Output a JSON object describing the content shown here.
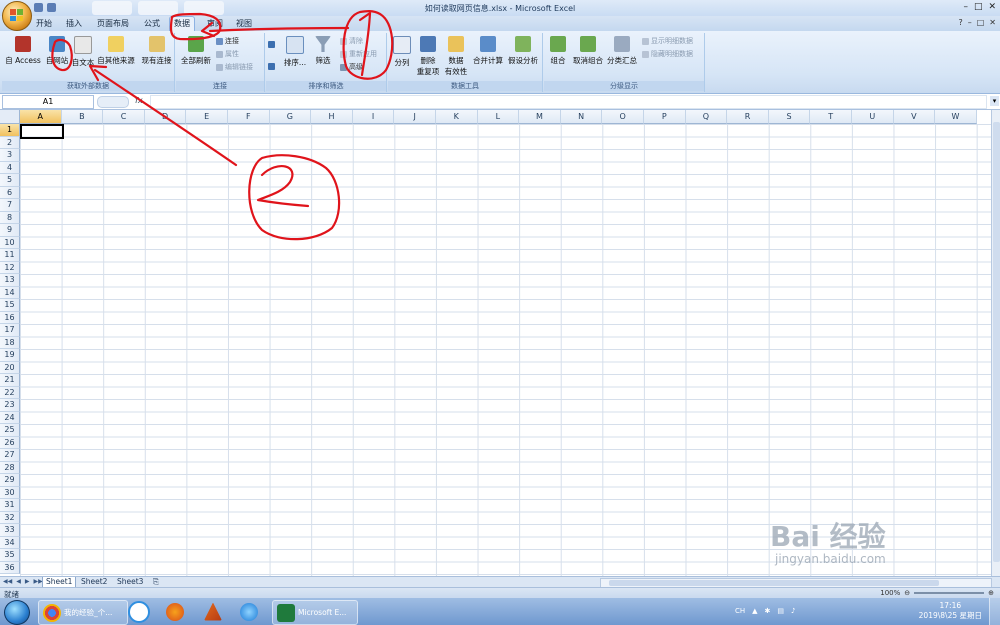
{
  "window": {
    "title": "如何读取网页信息.xlsx - Microsoft Excel",
    "controls": [
      "–",
      "□",
      "✕"
    ]
  },
  "tabs": [
    {
      "label": "开始",
      "active": false
    },
    {
      "label": "插入",
      "active": false
    },
    {
      "label": "页面布局",
      "active": false
    },
    {
      "label": "公式",
      "active": false
    },
    {
      "label": "数据",
      "active": true
    },
    {
      "label": "审阅",
      "active": false
    },
    {
      "label": "视图",
      "active": false
    }
  ],
  "ribbon": {
    "groups": [
      {
        "label": "获取外部数据"
      },
      {
        "label": "连接"
      },
      {
        "label": "排序和筛选"
      },
      {
        "label": "数据工具"
      },
      {
        "label": "分级显示"
      }
    ],
    "external": {
      "access": "自 Access",
      "web": "自网站",
      "text": "自文本",
      "other": "自其他来源",
      "existing": "现有连接"
    },
    "connections": {
      "refresh_all": "全部刷新",
      "connections": "连接",
      "properties": "属性",
      "edit_links": "编辑链接"
    },
    "sort": {
      "sort": "排序...",
      "filter": "筛选",
      "clear": "清除",
      "reapply": "重新应用",
      "advanced": "高级"
    },
    "tools": {
      "text_to_columns": "分列",
      "remove_dup_1": "删除",
      "remove_dup_2": "重复项",
      "validation_1": "数据",
      "validation_2": "有效性",
      "consolidate": "合并计算",
      "what_if": "假设分析"
    },
    "outline": {
      "group": "组合",
      "ungroup": "取消组合",
      "subtotal": "分类汇总",
      "show_detail": "显示明细数据",
      "hide_detail": "隐藏明细数据"
    }
  },
  "formula_bar": {
    "name_box": "A1",
    "fx": "fx",
    "value": ""
  },
  "sheet": {
    "columns": [
      "A",
      "B",
      "C",
      "D",
      "E",
      "F",
      "G",
      "H",
      "I",
      "J",
      "K",
      "L",
      "M",
      "N",
      "O",
      "P",
      "Q",
      "R",
      "S",
      "T",
      "U",
      "V",
      "W"
    ],
    "rows": [
      "1",
      "2",
      "3",
      "4",
      "5",
      "6",
      "7",
      "8",
      "9",
      "10",
      "11",
      "12",
      "13",
      "14",
      "15",
      "16",
      "17",
      "18",
      "19",
      "20",
      "21",
      "22",
      "23",
      "24",
      "25",
      "26",
      "27",
      "28",
      "29",
      "30",
      "31",
      "32",
      "33",
      "34",
      "35",
      "36"
    ],
    "active_cell": "A1"
  },
  "sheet_tabs": [
    {
      "label": "Sheet1",
      "active": true
    },
    {
      "label": "Sheet2",
      "active": false
    },
    {
      "label": "Sheet3",
      "active": false
    }
  ],
  "status": {
    "ready": "就绪",
    "zoom": "100%"
  },
  "taskbar": {
    "items": [
      {
        "label": "我的经验_个...",
        "icon": "chrome-icon"
      },
      {
        "label": "",
        "icon": "baidu-netdisk-icon"
      },
      {
        "label": "",
        "icon": "firefox-icon"
      },
      {
        "label": "",
        "icon": "matlab-icon"
      },
      {
        "label": "",
        "icon": "ie-icon"
      },
      {
        "label": "Microsoft E...",
        "icon": "excel-icon"
      }
    ],
    "tray_label": "CH",
    "time": "17:16",
    "date": "2019\\8\\25 星期日"
  },
  "watermark": {
    "logo": "Bai 经验",
    "url": "jingyan.baidu.com"
  },
  "colors": {
    "annotation": "#e0141b",
    "ribbon_bg": "#d6e5f6",
    "active_header": "#f1c15f",
    "taskbar": "#6f98cf"
  }
}
